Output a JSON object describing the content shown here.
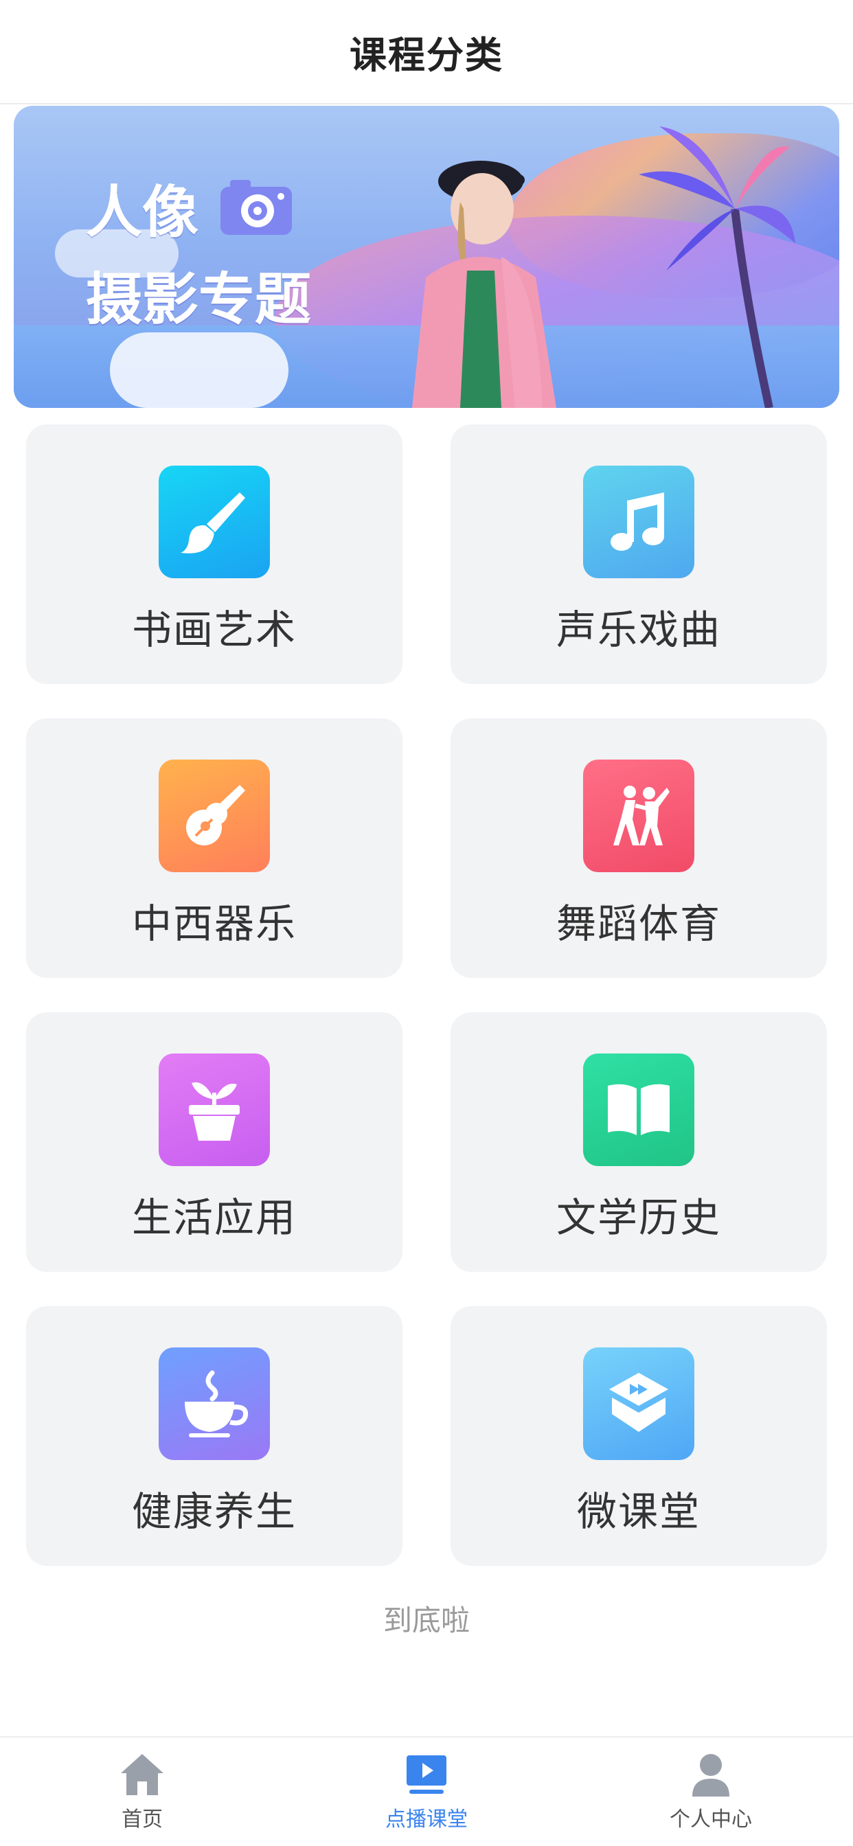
{
  "header": {
    "title": "课程分类"
  },
  "banner": {
    "line1": "人像",
    "line2": "摄影专题",
    "image": "portrait-photography-banner"
  },
  "categories": [
    {
      "label": "书画艺术",
      "icon": "brush-icon",
      "color_from": "#17d6f5",
      "color_to": "#1aa3f2"
    },
    {
      "label": "声乐戏曲",
      "icon": "music-note-icon",
      "color_from": "#5fd4ee",
      "color_to": "#4fa8ef"
    },
    {
      "label": "中西器乐",
      "icon": "guitar-icon",
      "color_from": "#ffb24d",
      "color_to": "#ff7f5a"
    },
    {
      "label": "舞蹈体育",
      "icon": "dance-icon",
      "color_from": "#ff6f87",
      "color_to": "#f14b67"
    },
    {
      "label": "生活应用",
      "icon": "plant-pot-icon",
      "color_from": "#e37cf5",
      "color_to": "#c75ff0"
    },
    {
      "label": "文学历史",
      "icon": "book-icon",
      "color_from": "#2fe0a4",
      "color_to": "#20c486"
    },
    {
      "label": "健康养生",
      "icon": "tea-cup-icon",
      "color_from": "#6fa0ff",
      "color_to": "#9a78f5"
    },
    {
      "label": "微课堂",
      "icon": "video-box-icon",
      "color_from": "#78d2fa",
      "color_to": "#4fa7f5"
    }
  ],
  "footer_note": "到底啦",
  "tabbar": {
    "items": [
      {
        "label": "首页",
        "icon": "home-icon",
        "active": false
      },
      {
        "label": "点播课堂",
        "icon": "play-screen-icon",
        "active": true
      },
      {
        "label": "个人中心",
        "icon": "user-icon",
        "active": false
      }
    ],
    "active_color": "#3a84ee",
    "inactive_color": "#9aa0aa"
  }
}
